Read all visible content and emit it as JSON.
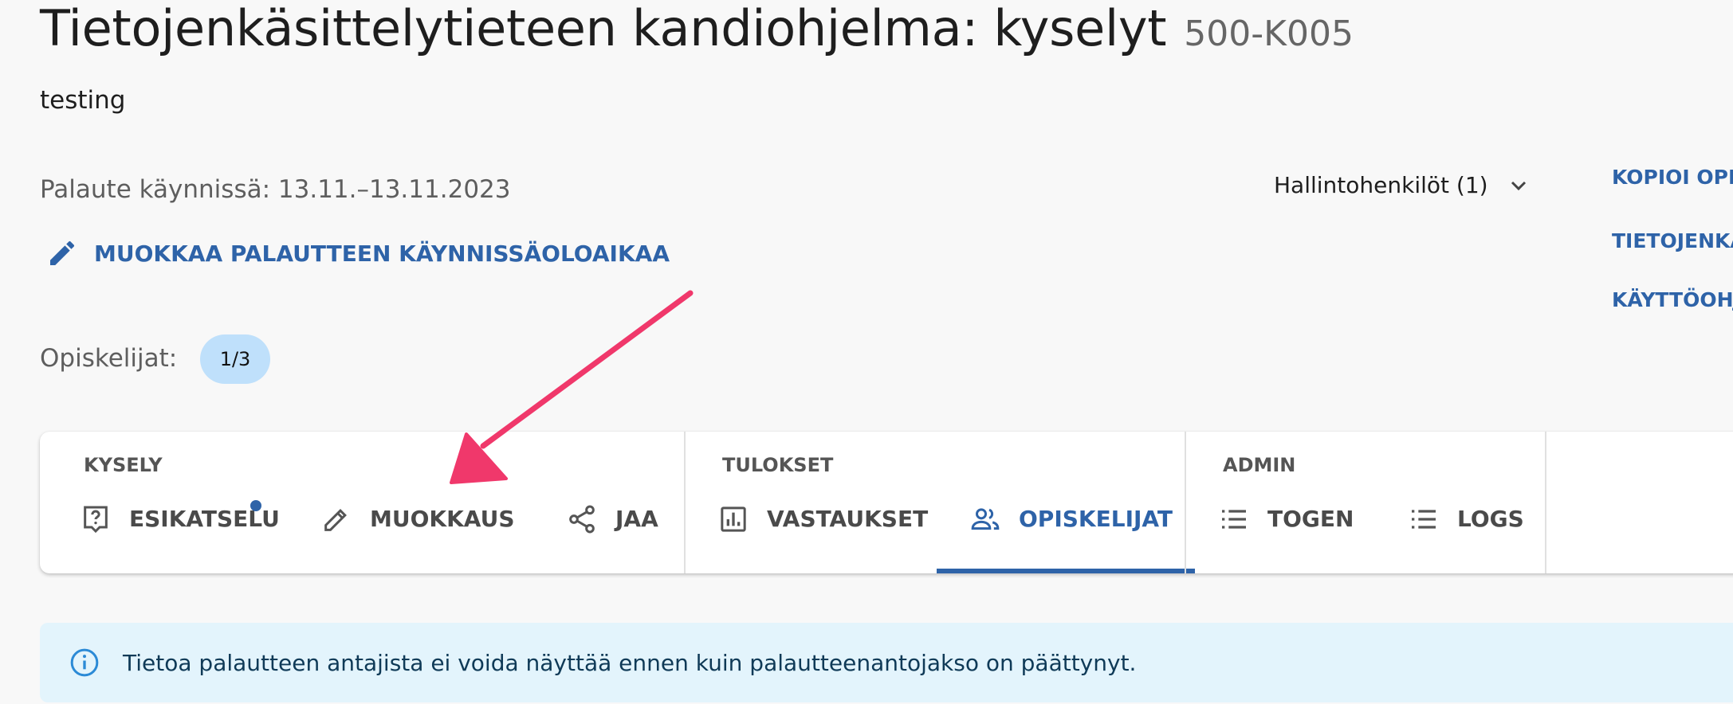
{
  "header": {
    "title": "Tietojenkäsittelytieteen kandiohjelma: kyselyt",
    "code": "500-K005",
    "description": "testing"
  },
  "feedback": {
    "period": "Palaute käynnissä: 13.11.–13.11.2023",
    "edit_period_label": "MUOKKAA PALAUTTEEN KÄYNNISSÄOLOAIKAA"
  },
  "students": {
    "label": "Opiskelijat:",
    "count": "1/3"
  },
  "admin_dropdown": {
    "label": "Hallintohenkilöt (1)"
  },
  "side_links": [
    {
      "label": "KOPIOI OPI"
    },
    {
      "label": "TIETOJENKÄ"
    },
    {
      "label": "KÄYTTÖOHJ"
    }
  ],
  "tabs": {
    "groups": [
      {
        "label": "KYSELY",
        "items": [
          {
            "label": "ESIKATSELU",
            "icon": "question-bubble-icon"
          },
          {
            "label": "MUOKKAUS",
            "icon": "pencil-icon"
          },
          {
            "label": "JAA",
            "icon": "share-icon"
          }
        ]
      },
      {
        "label": "TULOKSET",
        "items": [
          {
            "label": "VASTAUKSET",
            "icon": "bar-chart-icon"
          },
          {
            "label": "OPISKELIJAT",
            "icon": "people-icon",
            "active": true
          }
        ]
      },
      {
        "label": "ADMIN",
        "items": [
          {
            "label": "TOGEN",
            "icon": "list-icon"
          },
          {
            "label": "LOGS",
            "icon": "list-icon"
          }
        ]
      }
    ]
  },
  "info": {
    "text": "Tietoa palautteen antajista ei voida näyttää ennen kuin palautteenantojakso on päättynyt.",
    "icon": "info-icon"
  },
  "colors": {
    "accent": "#2e63a8",
    "badge_bg": "#bfe0fb",
    "info_bg": "#e3f4fc",
    "annotation_arrow": "#f0386b"
  }
}
